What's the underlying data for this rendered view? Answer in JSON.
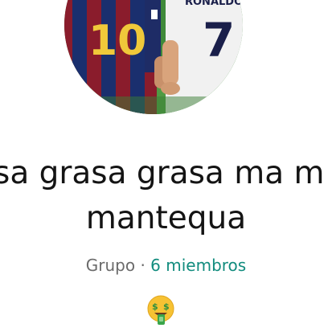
{
  "group": {
    "name_line1": "sa grasa grasa ma m",
    "name_line2": "mantequa",
    "type_label": "Grupo",
    "separator": "·",
    "members_label": "6 miembros",
    "description_emoji": "🤑"
  },
  "avatar": {
    "jersey_left_number": "10",
    "jersey_right_number": "7",
    "jersey_right_name": "RONALDO"
  },
  "colors": {
    "members_accent": "#128c7e",
    "title_text": "#141414",
    "meta_text": "#6b6b6b"
  }
}
